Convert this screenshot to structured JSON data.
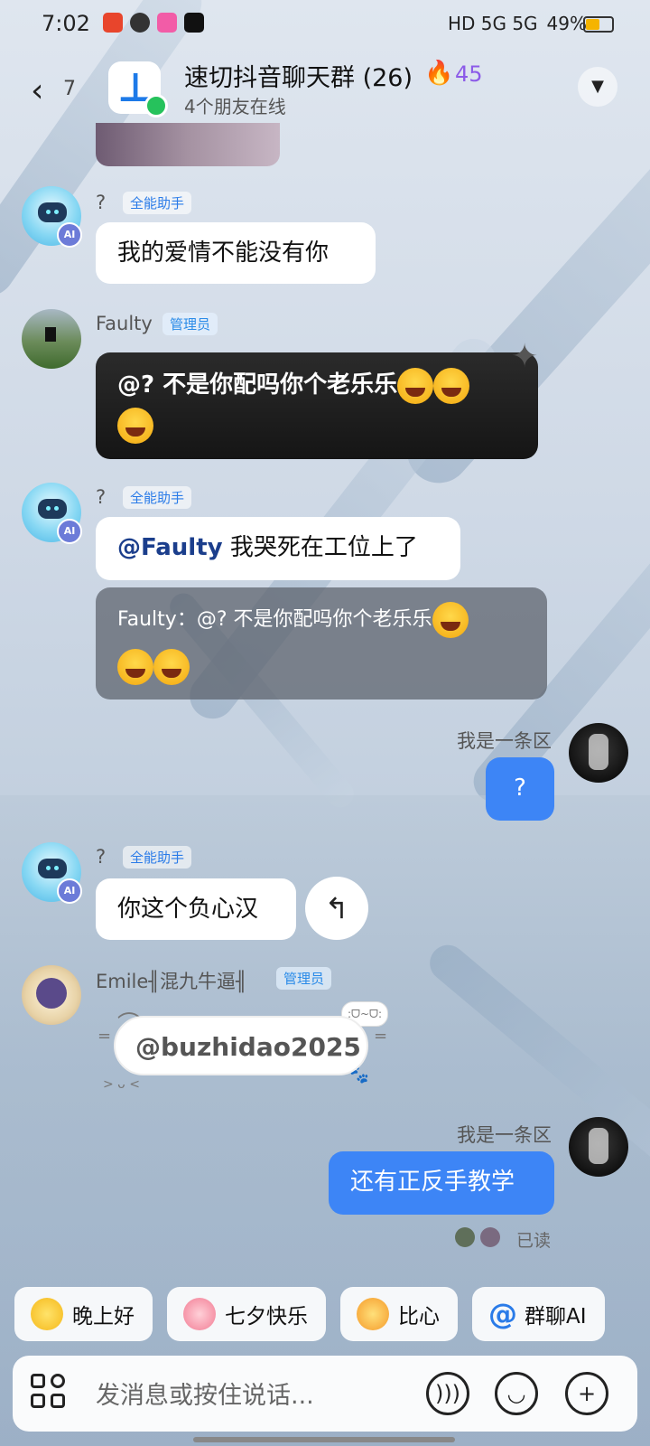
{
  "status_bar": {
    "time": "7:02",
    "network": "HD 5G 5G",
    "battery": "49%",
    "battery_level": 0.49
  },
  "header": {
    "back_count": "7",
    "group_title": "速切抖音聊天群 (26)",
    "fire_count": "45",
    "online_text": "4个朋友在线"
  },
  "messages": {
    "m1": {
      "sender": "?",
      "tag": "全能助手",
      "text": "我的爱情不能没有你"
    },
    "m2": {
      "sender": "Faulty",
      "tag": "管理员",
      "text": "@?  不是你配吗你个老乐乐"
    },
    "m3": {
      "sender": "?",
      "tag": "全能助手",
      "mention": "@Faulty",
      "text": " 我哭死在工位上了",
      "quote": "Faulty：@?  不是你配吗你个老乐乐"
    },
    "m4": {
      "sender": "我是一条区",
      "text": "?"
    },
    "m5": {
      "sender": "?",
      "tag": "全能助手",
      "text": "你这个负心汉"
    },
    "m6": {
      "sender": "Emile╢混九牛逼╢",
      "tag": "管理员",
      "text": "@buzhidao2025"
    },
    "m7": {
      "sender": "我是一条区",
      "text": "还有正反手教学",
      "read": "已读"
    }
  },
  "badges": {
    "ai": "AI"
  },
  "quick_replies": [
    {
      "label": "晚上好",
      "icon": "star-icon"
    },
    {
      "label": "七夕快乐",
      "icon": "bouquet-icon"
    },
    {
      "label": "比心",
      "icon": "heart-hands-icon"
    },
    {
      "label": "群聊AI",
      "icon": "at-icon"
    }
  ],
  "input": {
    "placeholder": "发消息或按住说话..."
  },
  "colors": {
    "self_bubble": "#3d85f6",
    "accent": "#2a7be8",
    "online": "#26c25c",
    "fire": "#9a5cf0"
  }
}
